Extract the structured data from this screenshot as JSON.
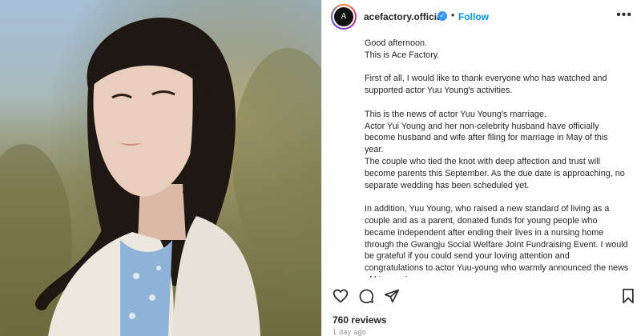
{
  "photo": {
    "icon": "portrait-photo",
    "colors": {
      "sky": "#9fb6c9",
      "foliage": "#6c6a3e",
      "hair": "#1e1712",
      "skin": "#e9cdbd",
      "cardigan": "#ece7df",
      "dress": "#8fb3d6"
    }
  },
  "header": {
    "avatar_letter": "A",
    "username": "acefactory.official",
    "verified_icon": "verified-badge-icon",
    "separator": "•",
    "follow_label": "Follow",
    "more_icon": "more-options-icon",
    "more_glyph": "•••"
  },
  "caption": {
    "paragraphs": [
      [
        "Good afternoon.",
        "This is Ace Factory."
      ],
      [
        "First of all, I would like to thank everyone who has watched and supported actor Yuu Young's activities."
      ],
      [
        "This is the news of actor Yuu Young's marriage.",
        "Actor Yui Young and her non-celebrity husband have officially become husband and wife after filing for marriage in May of this year.",
        "The couple who tied the knot with deep affection and trust will become parents this September. As the due date is approaching, no separate wedding has been scheduled yet."
      ],
      [
        "In addition, Yuu Young, who raised a new standard of living as a couple and as a parent, donated funds for young people who became independent after ending their lives in a nursing home through the Gwangju Social Welfare Joint Fundraising Event. I would be grateful if you could send your loving attention and congratulations to actor Yuu-young who warmly announced the news of his marriage."
      ]
    ]
  },
  "actions": {
    "like_icon": "heart-icon",
    "comment_icon": "comment-icon",
    "share_icon": "share-icon",
    "save_icon": "bookmark-icon"
  },
  "footer": {
    "reviews": "760 reviews",
    "time_ago": "1 day ago"
  },
  "colors": {
    "accent": "#0095f6",
    "verified": "#3897f0",
    "text": "#262626",
    "muted": "#8e8e8e"
  }
}
